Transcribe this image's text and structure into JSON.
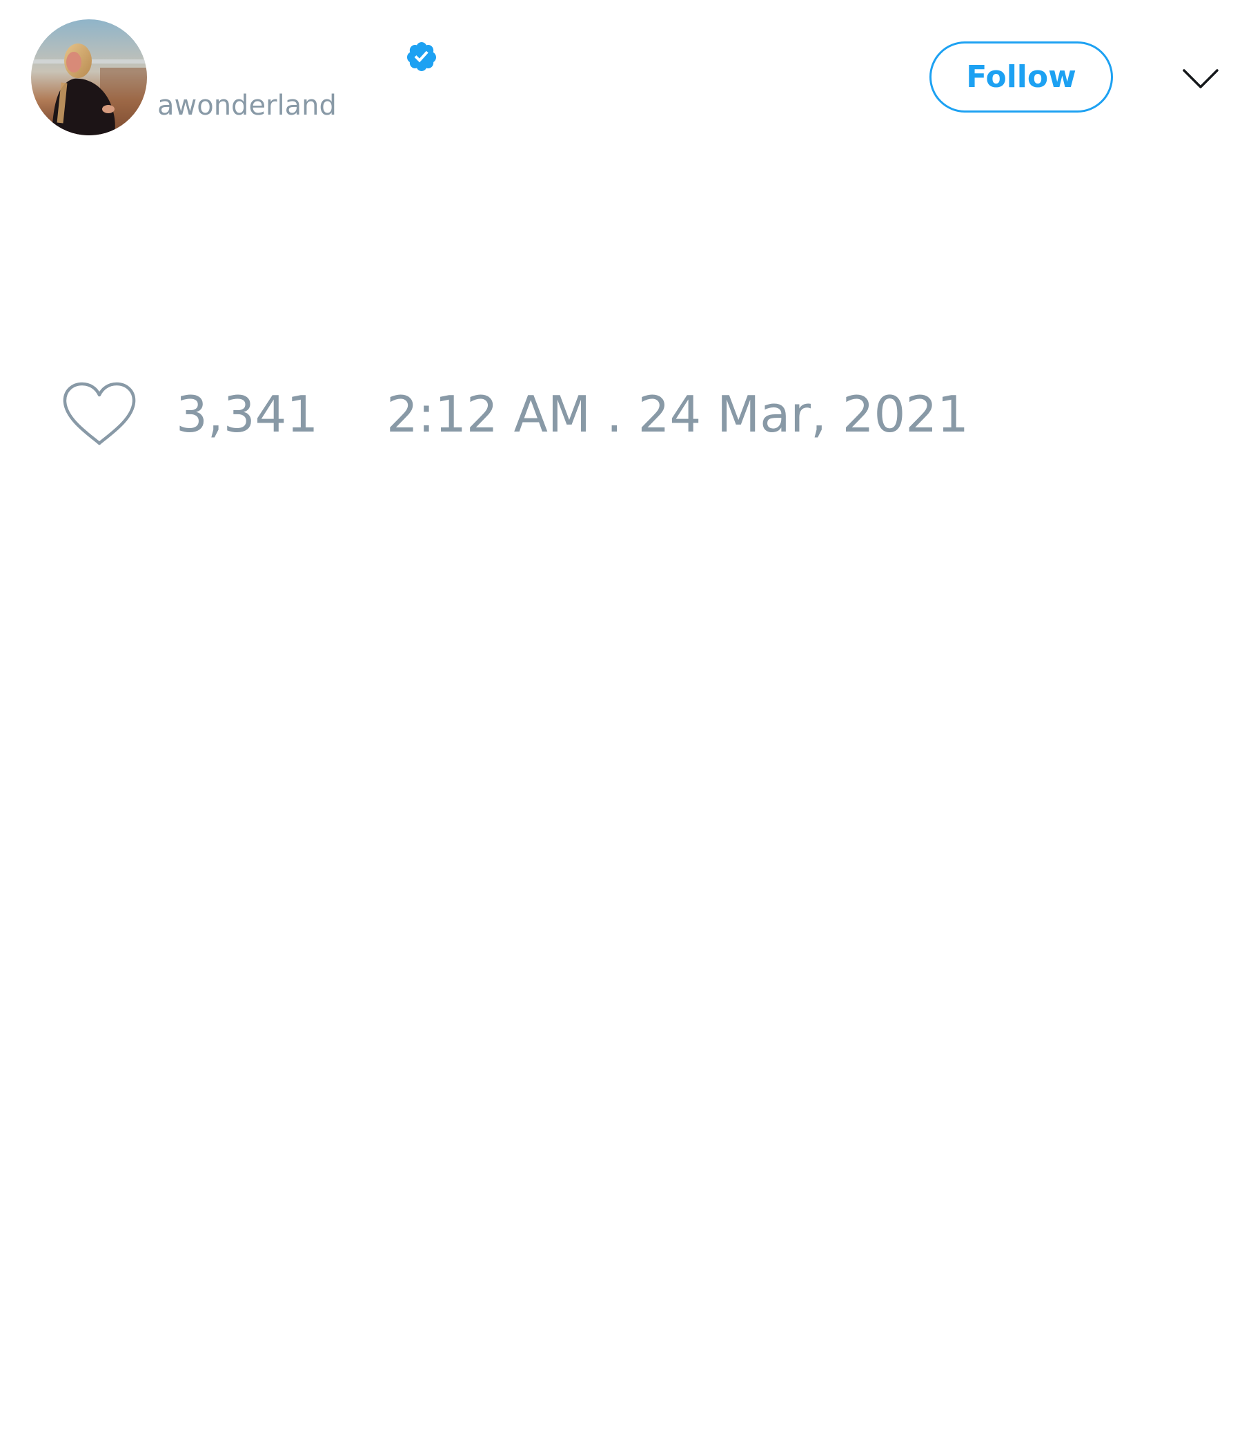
{
  "tweet": {
    "display_name": "",
    "handle": "awonderland",
    "follow_label": "Follow",
    "like_count": "3,341",
    "timestamp": "2:12 AM . 24 Mar, 2021"
  },
  "icons": {
    "verified": "verified-badge-icon",
    "menu": "chevron-down-icon",
    "like": "heart-icon",
    "avatar": "profile-photo"
  },
  "colors": {
    "accent": "#1da1f2",
    "secondary_text": "#8899a6",
    "background": "#ffffff"
  }
}
